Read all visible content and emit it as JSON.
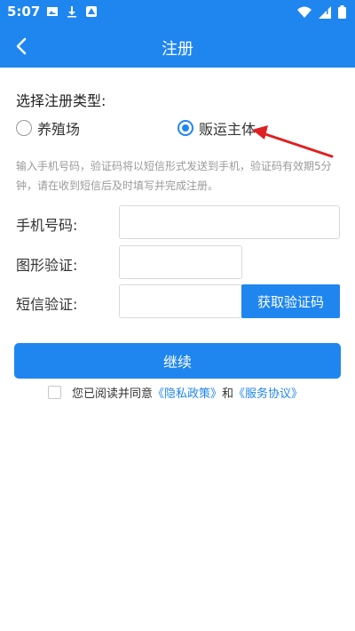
{
  "status_bar": {
    "time": "5:07",
    "left_icons": [
      "image-icon",
      "download-icon",
      "app-icon"
    ],
    "right_icons": [
      "wifi-icon",
      "signal-icon",
      "battery-icon"
    ]
  },
  "nav": {
    "title": "注册",
    "back_icon": "chevron-left-icon"
  },
  "form": {
    "type_label": "选择注册类型:",
    "options": [
      {
        "label": "养殖场",
        "selected": false
      },
      {
        "label": "贩运主体",
        "selected": true
      }
    ],
    "hint": "输入手机号码，验证码将以短信形式发送到手机，验证码有效期5分钟，请在收到短信后及时填写并完成注册。",
    "fields": [
      {
        "label": "手机号码:",
        "value": "",
        "placeholder": ""
      },
      {
        "label": "图形验证:",
        "value": "",
        "placeholder": ""
      },
      {
        "label": "短信验证:",
        "value": "",
        "placeholder": ""
      }
    ],
    "sms_button": "获取验证码",
    "continue_button": "继续",
    "agreement": {
      "checked": false,
      "prefix": "您已阅读并同意",
      "privacy_link": "《隐私政策》",
      "and": "和",
      "service_link": "《服务协议》"
    }
  },
  "colors": {
    "primary": "#1f86f0",
    "annotation": "#e02020"
  }
}
